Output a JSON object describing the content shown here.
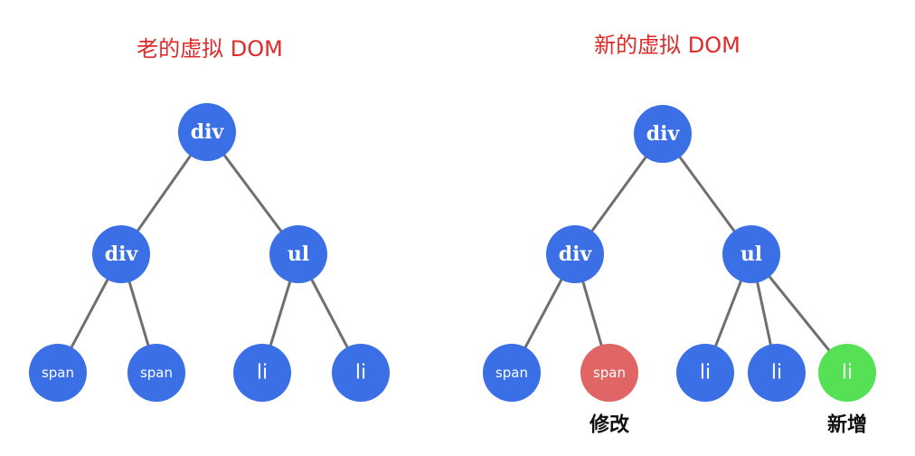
{
  "titles": {
    "old": "老的虚拟 DOM",
    "new": "新的虚拟 DOM"
  },
  "old_tree": {
    "root": "div",
    "left": "div",
    "right": "ul",
    "left_children": [
      "span",
      "span"
    ],
    "right_children": [
      "li",
      "li"
    ]
  },
  "new_tree": {
    "root": "div",
    "left": "div",
    "right": "ul",
    "left_children": [
      "span",
      "span"
    ],
    "right_children": [
      "li",
      "li",
      "li"
    ]
  },
  "annotations": {
    "modified": "修改",
    "added": "新增"
  },
  "colors": {
    "title": "#e02a2a",
    "node_default": "#3a6fe6",
    "node_modified": "#e06565",
    "node_added": "#55e055",
    "edge": "#6f6f6f",
    "node_text": "#ffffff",
    "annotation_text": "#111111"
  }
}
